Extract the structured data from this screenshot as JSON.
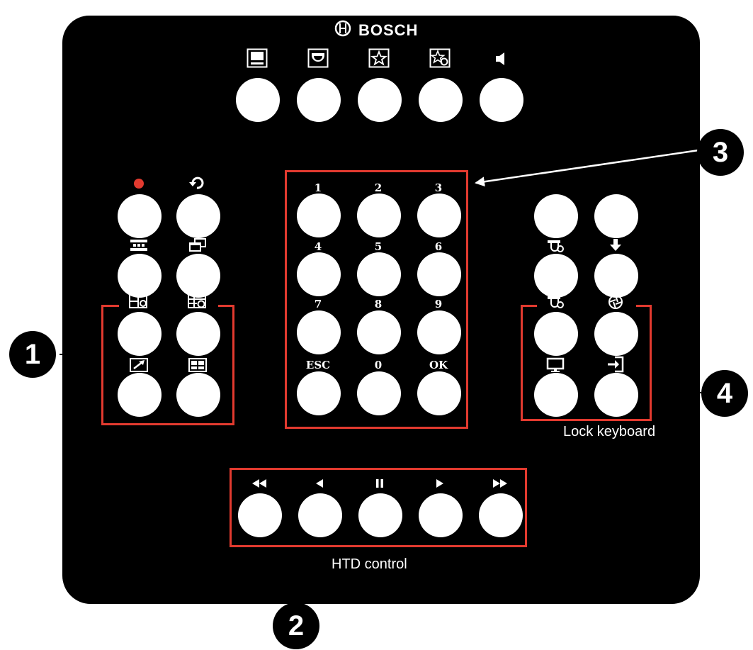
{
  "brand": {
    "name": "BOSCH",
    "logo_icon": "bosch-armature-icon"
  },
  "top_row": [
    {
      "icon": "monitor-icon"
    },
    {
      "icon": "camera-dome-icon"
    },
    {
      "icon": "star-favorite-icon"
    },
    {
      "icon": "star-settings-icon"
    },
    {
      "icon": "speaker-icon"
    }
  ],
  "left_group": [
    {
      "icon": "record-dot-icon",
      "color": "#e23a2f"
    },
    {
      "icon": "return-arrow-icon"
    },
    {
      "icon": "sequence-icon"
    },
    {
      "icon": "multi-window-icon"
    },
    {
      "icon": "layout-minus-icon"
    },
    {
      "icon": "layout-settings-icon"
    },
    {
      "icon": "zoom-arrow-icon"
    },
    {
      "icon": "image-grid-icon"
    }
  ],
  "keypad": {
    "labels": [
      "1",
      "2",
      "3",
      "4",
      "5",
      "6",
      "7",
      "8",
      "9",
      "ESC",
      "0",
      "OK"
    ]
  },
  "right_group": [
    {
      "icon": "none"
    },
    {
      "icon": "none"
    },
    {
      "icon": "camera-move-icon"
    },
    {
      "icon": "download-icon"
    },
    {
      "icon": "camera-settings-icon"
    },
    {
      "icon": "aperture-icon"
    },
    {
      "icon": "monitor-small-icon"
    },
    {
      "icon": "login-icon"
    }
  ],
  "lock_caption": "Lock keyboard",
  "htd": {
    "caption": "HTD control",
    "buttons": [
      {
        "icon": "fast-rewind-icon"
      },
      {
        "icon": "rewind-icon"
      },
      {
        "icon": "pause-icon"
      },
      {
        "icon": "play-icon"
      },
      {
        "icon": "fast-forward-icon"
      }
    ]
  },
  "callouts": [
    "1",
    "2",
    "3",
    "4"
  ],
  "colors": {
    "panel": "#000000",
    "highlight": "#e23a2f",
    "button": "#ffffff"
  }
}
